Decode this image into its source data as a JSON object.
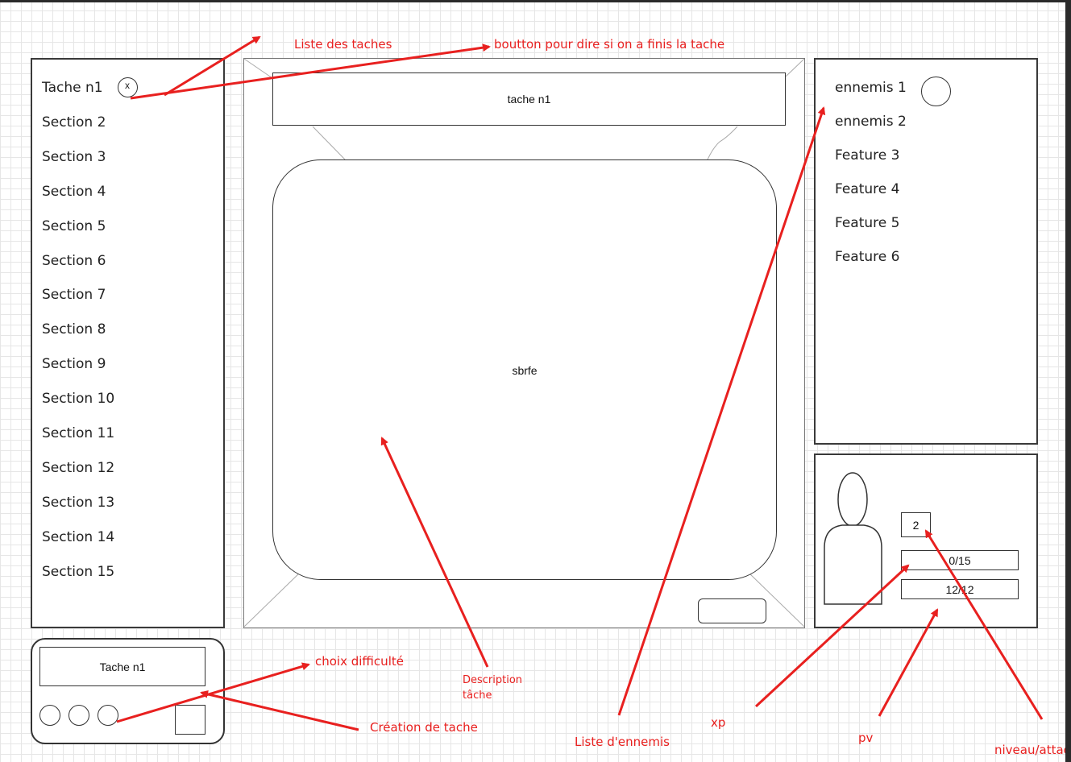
{
  "task_list": {
    "items": [
      "Tache n1",
      "Section 2",
      "Section 3",
      "Section 4",
      "Section 5",
      "Section 6",
      "Section 7",
      "Section 8",
      "Section 9",
      "Section 10",
      "Section 11",
      "Section 12",
      "Section 13",
      "Section 14",
      "Section 15"
    ],
    "done_button": "x"
  },
  "task_view": {
    "title": "tache n1",
    "description": "sbrfe"
  },
  "enemy_list": {
    "items": [
      "ennemis 1",
      "ennemis 2",
      "Feature 3",
      "Feature 4",
      "Feature 5",
      "Feature 6"
    ]
  },
  "player": {
    "level": "2",
    "xp": "0/15",
    "pv": "12/12"
  },
  "task_creation": {
    "name": "Tache n1"
  },
  "annotations": {
    "task_list": "Liste des taches",
    "done_button": "boutton pour dire si on a finis la tache",
    "difficulty": "choix difficulté",
    "description": "Description tâche",
    "creation": "Création de tache",
    "enemy_list": "Liste d'ennemis",
    "xp": "xp",
    "pv": "pv",
    "level": "niveau/attaq"
  },
  "colors": {
    "annotation": "#e8201f",
    "stroke": "#333333"
  }
}
